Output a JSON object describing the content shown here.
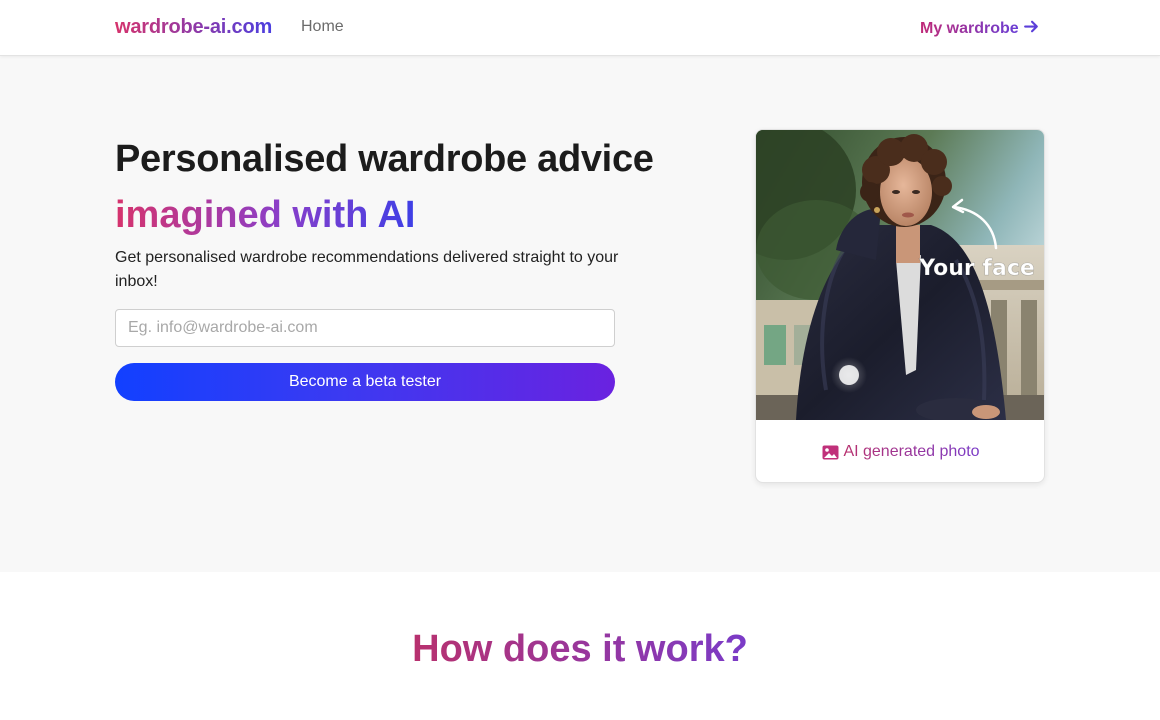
{
  "nav": {
    "brand": "wardrobe-ai.com",
    "home": "Home",
    "my_wardrobe": "My wardrobe",
    "arrow_icon": "arrow-right-icon"
  },
  "hero": {
    "title_line1": "Personalised wardrobe advice",
    "title_line2": "imagined with AI",
    "subtitle": "Get personalised wardrobe recommendations delivered straight to your inbox!",
    "email_placeholder": "Eg. info@wardrobe-ai.com",
    "email_value": "",
    "cta_label": "Become a beta tester"
  },
  "card": {
    "overlay_text": "Your face",
    "caption": "AI generated photo",
    "caption_icon": "image-icon"
  },
  "how": {
    "title": "How does it work?"
  },
  "colors": {
    "brand_pink": "#d6336c",
    "brand_purple": "#7a3bc8",
    "brand_blue": "#1240ff",
    "hero_bg": "#f8f8f8"
  }
}
